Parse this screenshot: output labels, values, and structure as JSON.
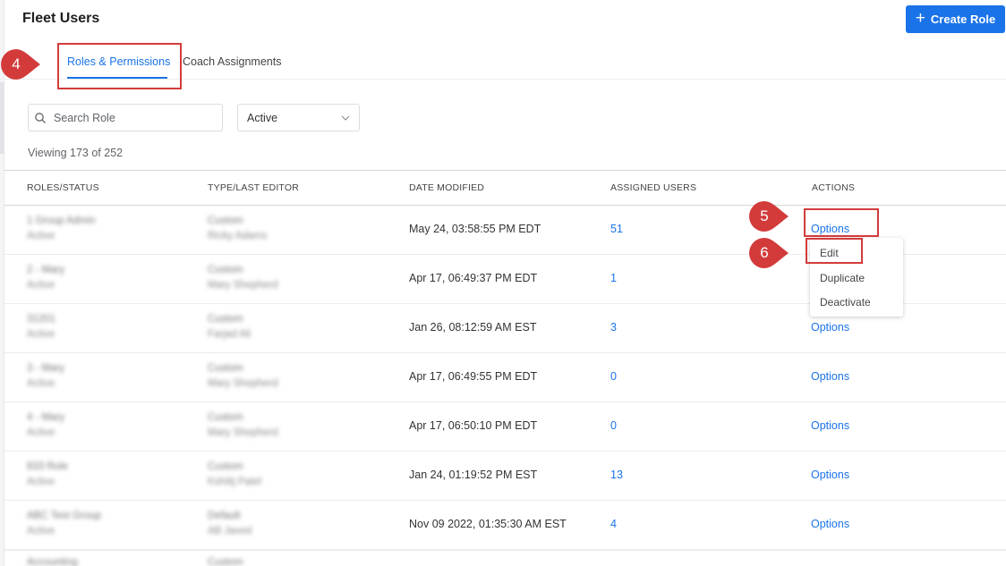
{
  "header": {
    "title": "Fleet Users",
    "create_label": "Create Role"
  },
  "tabs": [
    {
      "label": "Roles & Permissions",
      "active": true
    },
    {
      "label": "Coach Assignments",
      "active": false
    }
  ],
  "filters": {
    "search_placeholder": "Search Role",
    "status_value": "Active"
  },
  "viewing_text": "Viewing 173 of 252",
  "table": {
    "headers": [
      "ROLES/STATUS",
      "TYPE/LAST EDITOR",
      "DATE MODIFIED",
      "ASSIGNED USERS",
      "ACTIONS"
    ],
    "rows": [
      {
        "role": "1 Group Admin",
        "status": "Active",
        "type": "Custom",
        "editor": "Ricky Adams",
        "date": "May 24, 03:58:55 PM EDT",
        "users": "51",
        "action": "Options"
      },
      {
        "role": "2 - Mary",
        "status": "Active",
        "type": "Custom",
        "editor": "Mary Shepherd",
        "date": "Apr 17, 06:49:37 PM EDT",
        "users": "1",
        "action": "Options"
      },
      {
        "role": "31201",
        "status": "Active",
        "type": "Custom",
        "editor": "Farjad Ali",
        "date": "Jan 26, 08:12:59 AM EST",
        "users": "3",
        "action": "Options"
      },
      {
        "role": "3 - Mary",
        "status": "Active",
        "type": "Custom",
        "editor": "Mary Shepherd",
        "date": "Apr 17, 06:49:55 PM EDT",
        "users": "0",
        "action": "Options"
      },
      {
        "role": "4 - Mary",
        "status": "Active",
        "type": "Custom",
        "editor": "Mary Shepherd",
        "date": "Apr 17, 06:50:10 PM EDT",
        "users": "0",
        "action": "Options"
      },
      {
        "role": "633 Role",
        "status": "Active",
        "type": "Custom",
        "editor": "Kshitij Patel",
        "date": "Jan 24, 01:19:52 PM EST",
        "users": "13",
        "action": "Options"
      },
      {
        "role": "ABC Test Group",
        "status": "Active",
        "type": "Default",
        "editor": "AB Javed",
        "date": "Nov 09 2022, 01:35:30 AM EST",
        "users": "4",
        "action": "Options"
      },
      {
        "role": "Accounting",
        "status": "Active",
        "type": "Custom",
        "editor": "",
        "date": "",
        "users": "",
        "action": ""
      }
    ]
  },
  "options_menu": {
    "items": [
      "Edit",
      "Duplicate",
      "Deactivate"
    ]
  },
  "annotations": [
    {
      "step": "4"
    },
    {
      "step": "5"
    },
    {
      "step": "6"
    }
  ],
  "colors": {
    "accent": "#1a73e8",
    "annotation": "#d33b3b"
  }
}
